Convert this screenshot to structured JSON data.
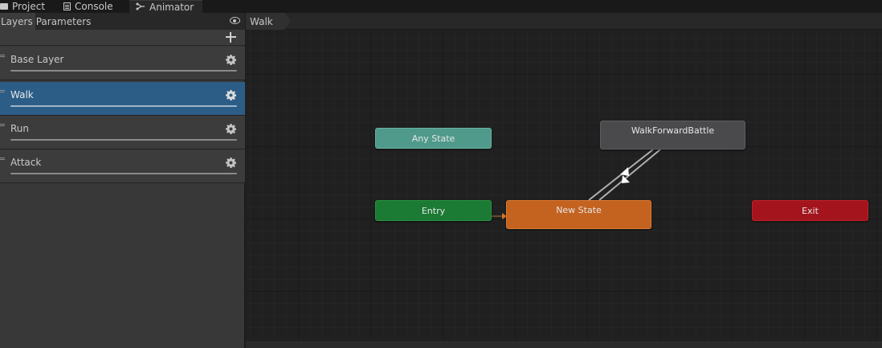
{
  "tabs": {
    "project": "Project",
    "console": "Console",
    "animator": "Animator"
  },
  "subtabs": {
    "layers": "Layers",
    "parameters": "Parameters"
  },
  "layers": [
    {
      "name": "Base Layer",
      "selected": false
    },
    {
      "name": "Walk",
      "selected": true
    },
    {
      "name": "Run",
      "selected": false
    },
    {
      "name": "Attack",
      "selected": false
    }
  ],
  "breadcrumb": "Walk",
  "states": {
    "any_state": "Any State",
    "walk_forward": "WalkForwardBattle",
    "entry": "Entry",
    "new_state": "New State",
    "exit": "Exit"
  },
  "colors": {
    "any_state": "#4f9a8a",
    "entry": "#1b7a33",
    "default_state": "#c4621f",
    "exit": "#a4141c",
    "state": "#4a4a4d",
    "selected_layer": "#2c5d87"
  }
}
